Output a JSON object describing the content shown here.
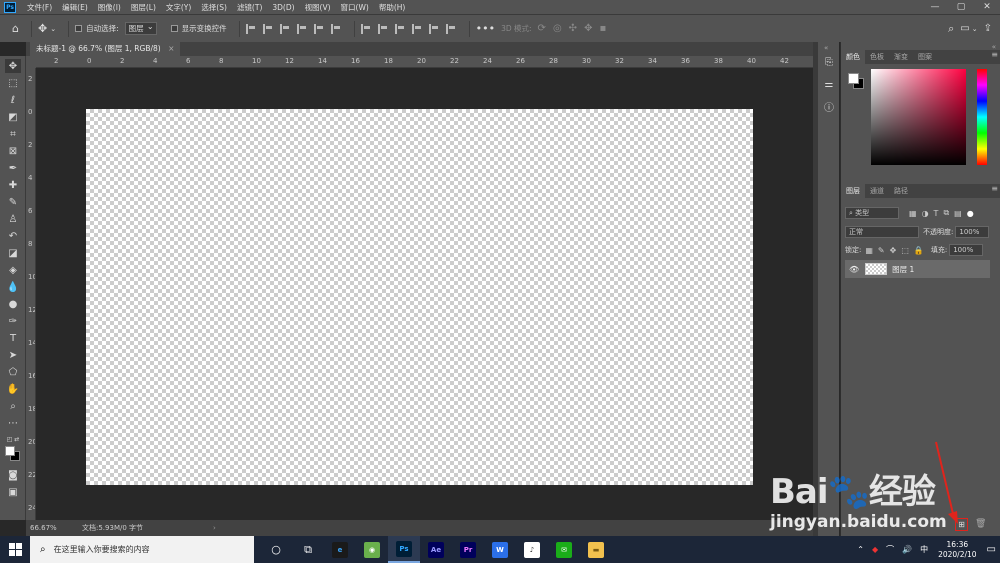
{
  "app": {
    "logo": "Ps",
    "menu": [
      "文件(F)",
      "编辑(E)",
      "图像(I)",
      "图层(L)",
      "文字(Y)",
      "选择(S)",
      "滤镜(T)",
      "3D(D)",
      "视图(V)",
      "窗口(W)",
      "帮助(H)"
    ],
    "window_controls": [
      "—",
      "▢",
      "✕"
    ]
  },
  "options": {
    "auto_select_label": "自动选择:",
    "auto_select_value": "图层",
    "transform_label": "显示变换控件",
    "mode3d_label": "3D 模式:"
  },
  "document": {
    "tab_title": "未标题-1 @ 66.7% (图层 1, RGB/8)",
    "tab_close": "×",
    "zoom": "66.67%",
    "doc_info": "文档:5.93M/0 字节",
    "status_arrow": "›"
  },
  "rulers": {
    "top": [
      "2",
      "0",
      "2",
      "4",
      "6",
      "8",
      "10",
      "12",
      "14",
      "16",
      "18",
      "20",
      "22",
      "24",
      "26",
      "28",
      "30",
      "32",
      "34",
      "36",
      "38",
      "40",
      "42"
    ],
    "left": [
      "2",
      "0",
      "2",
      "4",
      "6",
      "8",
      "10",
      "12",
      "14",
      "16",
      "18",
      "20",
      "22",
      "24"
    ]
  },
  "panels": {
    "color_tabs": [
      "颜色",
      "色板",
      "渐变",
      "图案"
    ],
    "layer_tabs": [
      "图层",
      "通道",
      "路径"
    ],
    "menu_icon": "≡",
    "filter_kind": "类型",
    "blend_mode": "正常",
    "opacity_label": "不透明度:",
    "opacity_value": "100%",
    "lock_label": "锁定:",
    "fill_label": "填充:",
    "fill_value": "100%",
    "layer_name": "图层 1"
  },
  "taskbar": {
    "search_placeholder": "在这里输入你要搜索的内容",
    "apps": [
      {
        "label": "e",
        "bg": "#1a1a1a",
        "fg": "#3aa0f0"
      },
      {
        "label": "◉",
        "bg": "#6ab04c",
        "fg": "#ffffff"
      },
      {
        "label": "Ps",
        "bg": "#001e36",
        "fg": "#31a8ff"
      },
      {
        "label": "Ae",
        "bg": "#00005b",
        "fg": "#9999ff"
      },
      {
        "label": "Pr",
        "bg": "#00005b",
        "fg": "#ea77ff"
      },
      {
        "label": "W",
        "bg": "#2b6fe8",
        "fg": "#ffffff"
      },
      {
        "label": "♪",
        "bg": "#ffffff",
        "fg": "#333333"
      },
      {
        "label": "✉",
        "bg": "#1aad19",
        "fg": "#ffffff"
      },
      {
        "label": "▬",
        "bg": "#f2c14e",
        "fg": "#7a5a10"
      }
    ],
    "ime": "中",
    "time": "16:36",
    "date": "2020/2/10"
  },
  "watermark": {
    "logo": "Bai🐾经验",
    "url": "jingyan.baidu.com"
  },
  "colors": {
    "accent_red": "#e0241c",
    "ps_blue": "#31a8ff"
  }
}
